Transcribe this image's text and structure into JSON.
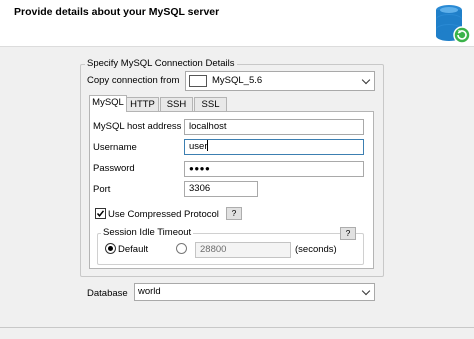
{
  "header": {
    "title": "Provide details about your MySQL server"
  },
  "connection_group": {
    "legend": "Specify MySQL Connection Details",
    "copy_label": "Copy connection from",
    "copy_value": "MySQL_5.6"
  },
  "tabs": [
    {
      "label": "MySQL",
      "active": true
    },
    {
      "label": "HTTP",
      "active": false
    },
    {
      "label": "SSH",
      "active": false
    },
    {
      "label": "SSL",
      "active": false
    }
  ],
  "mysql_tab": {
    "host_label": "MySQL host address",
    "host_value": "localhost",
    "username_label": "Username",
    "username_value": "user",
    "password_label": "Password",
    "password_value": "●●●●",
    "port_label": "Port",
    "port_value": "3306",
    "compressed_label": "Use Compressed Protocol",
    "compressed_checked": true,
    "help_label": "?",
    "session_legend": "Session Idle Timeout",
    "default_label": "Default",
    "custom_value": "28800",
    "seconds_label": "(seconds)",
    "selected_timeout": "Default"
  },
  "database": {
    "label": "Database",
    "value": "world"
  },
  "icons": {
    "header_icon": "database-refresh-icon"
  },
  "colors": {
    "icon_blue": "#1f7fc9",
    "icon_green": "#3bb34a",
    "focus_border": "#3c7fb1"
  }
}
